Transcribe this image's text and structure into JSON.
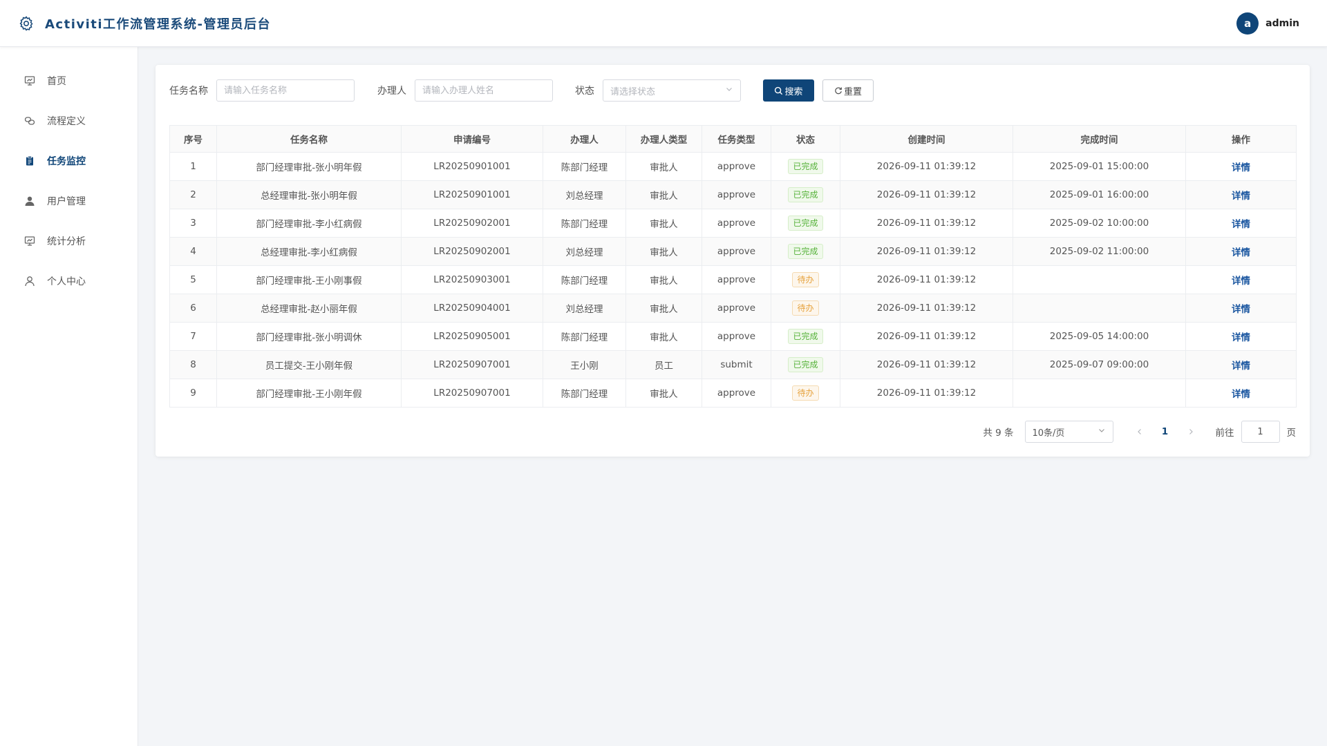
{
  "header": {
    "title": "Activiti工作流管理系统-管理员后台",
    "logo_icon": "gear-icon",
    "user": {
      "avatar_letter": "a",
      "name": "admin"
    }
  },
  "colors": {
    "primary": "#0f4578",
    "done": "#56b23a",
    "todo": "#e6a23c"
  },
  "sidebar": {
    "items": [
      {
        "label": "首页",
        "icon": "presentation-icon",
        "active": false
      },
      {
        "label": "流程定义",
        "icon": "chain-link-icon",
        "active": false
      },
      {
        "label": "任务监控",
        "icon": "clipboard-icon",
        "active": true
      },
      {
        "label": "用户管理",
        "icon": "user-filled-icon",
        "active": false
      },
      {
        "label": "统计分析",
        "icon": "chart-board-icon",
        "active": false
      },
      {
        "label": "个人中心",
        "icon": "user-outline-icon",
        "active": false
      }
    ]
  },
  "filters": {
    "task_name": {
      "label": "任务名称",
      "placeholder": "请输入任务名称",
      "value": ""
    },
    "assignee": {
      "label": "办理人",
      "placeholder": "请输入办理人姓名",
      "value": ""
    },
    "status": {
      "label": "状态",
      "placeholder": "请选择状态"
    },
    "search_label": "搜索",
    "reset_label": "重置"
  },
  "table": {
    "columns": [
      "序号",
      "任务名称",
      "申请编号",
      "办理人",
      "办理人类型",
      "任务类型",
      "状态",
      "创建时间",
      "完成时间",
      "操作"
    ],
    "rows": [
      {
        "index": "1",
        "name": "部门经理审批-张小明年假",
        "code": "LR20250901001",
        "assignee": "陈部门经理",
        "assignee_type": "审批人",
        "task_type": "approve",
        "status": "已完成",
        "created": "2026-09-11 01:39:12",
        "finished": "2025-09-01 15:00:00",
        "action": "详情"
      },
      {
        "index": "2",
        "name": "总经理审批-张小明年假",
        "code": "LR20250901001",
        "assignee": "刘总经理",
        "assignee_type": "审批人",
        "task_type": "approve",
        "status": "已完成",
        "created": "2026-09-11 01:39:12",
        "finished": "2025-09-01 16:00:00",
        "action": "详情"
      },
      {
        "index": "3",
        "name": "部门经理审批-李小红病假",
        "code": "LR20250902001",
        "assignee": "陈部门经理",
        "assignee_type": "审批人",
        "task_type": "approve",
        "status": "已完成",
        "created": "2026-09-11 01:39:12",
        "finished": "2025-09-02 10:00:00",
        "action": "详情"
      },
      {
        "index": "4",
        "name": "总经理审批-李小红病假",
        "code": "LR20250902001",
        "assignee": "刘总经理",
        "assignee_type": "审批人",
        "task_type": "approve",
        "status": "已完成",
        "created": "2026-09-11 01:39:12",
        "finished": "2025-09-02 11:00:00",
        "action": "详情"
      },
      {
        "index": "5",
        "name": "部门经理审批-王小刚事假",
        "code": "LR20250903001",
        "assignee": "陈部门经理",
        "assignee_type": "审批人",
        "task_type": "approve",
        "status": "待办",
        "created": "2026-09-11 01:39:12",
        "finished": "",
        "action": "详情"
      },
      {
        "index": "6",
        "name": "总经理审批-赵小丽年假",
        "code": "LR20250904001",
        "assignee": "刘总经理",
        "assignee_type": "审批人",
        "task_type": "approve",
        "status": "待办",
        "created": "2026-09-11 01:39:12",
        "finished": "",
        "action": "详情"
      },
      {
        "index": "7",
        "name": "部门经理审批-张小明调休",
        "code": "LR20250905001",
        "assignee": "陈部门经理",
        "assignee_type": "审批人",
        "task_type": "approve",
        "status": "已完成",
        "created": "2026-09-11 01:39:12",
        "finished": "2025-09-05 14:00:00",
        "action": "详情"
      },
      {
        "index": "8",
        "name": "员工提交-王小刚年假",
        "code": "LR20250907001",
        "assignee": "王小刚",
        "assignee_type": "员工",
        "task_type": "submit",
        "status": "已完成",
        "created": "2026-09-11 01:39:12",
        "finished": "2025-09-07 09:00:00",
        "action": "详情"
      },
      {
        "index": "9",
        "name": "部门经理审批-王小刚年假",
        "code": "LR20250907001",
        "assignee": "陈部门经理",
        "assignee_type": "审批人",
        "task_type": "approve",
        "status": "待办",
        "created": "2026-09-11 01:39:12",
        "finished": "",
        "action": "详情"
      }
    ]
  },
  "pagination": {
    "total_text": "共 9 条",
    "page_size": "10条/页",
    "current_page": "1",
    "goto_label": "前往",
    "goto_value": "1",
    "goto_unit": "页"
  }
}
